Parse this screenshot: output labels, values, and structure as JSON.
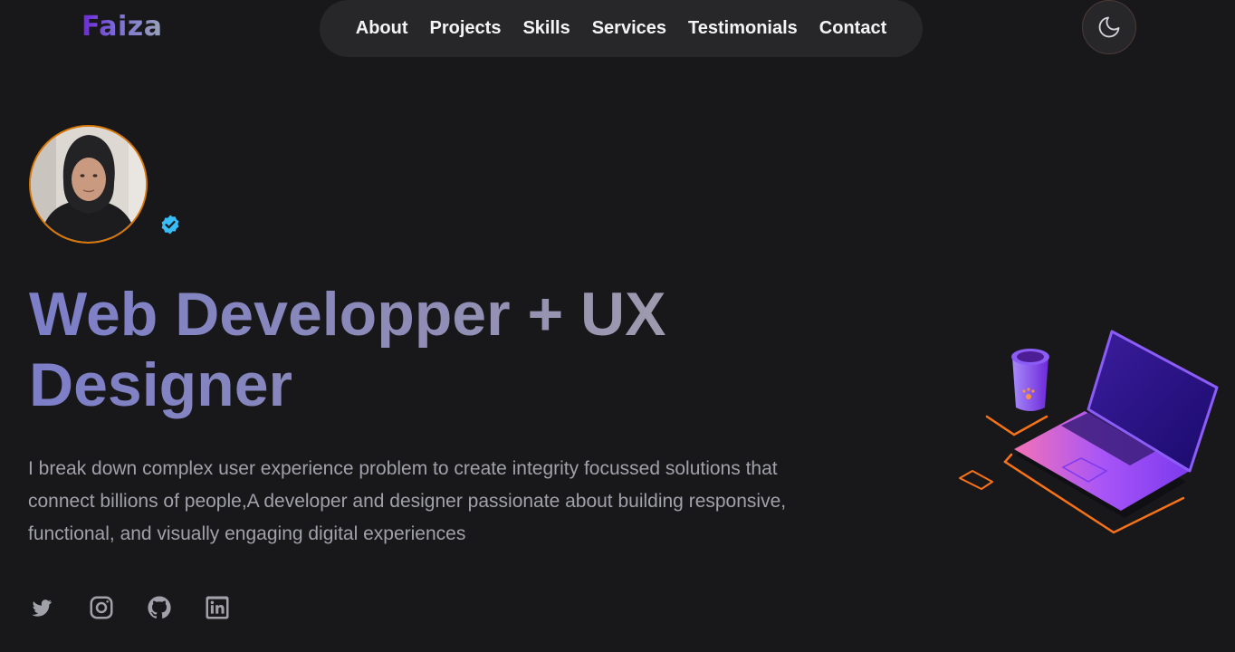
{
  "header": {
    "logo": "Faiza",
    "nav": [
      "About",
      "Projects",
      "Skills",
      "Services",
      "Testimonials",
      "Contact"
    ],
    "theme_toggle_icon": "moon-icon"
  },
  "hero": {
    "avatar_icon": "profile-photo",
    "verified_icon": "verified-badge-icon",
    "headline": "Web Developper + UX Designer",
    "bio": "I break down complex user experience problem to create integrity focussed solutions that connect billions of people,A developer and designer passionate about building responsive, functional, and visually engaging digital experiences",
    "illustration_icon": "laptop-and-cup-illustration"
  },
  "socials": [
    "twitter-icon",
    "instagram-icon",
    "github-icon",
    "linkedin-icon"
  ],
  "colors": {
    "background": "#18181b",
    "nav_background": "#27272a",
    "accent": "#6d28d9",
    "avatar_ring": "#d97706",
    "verified": "#38bdf8"
  }
}
